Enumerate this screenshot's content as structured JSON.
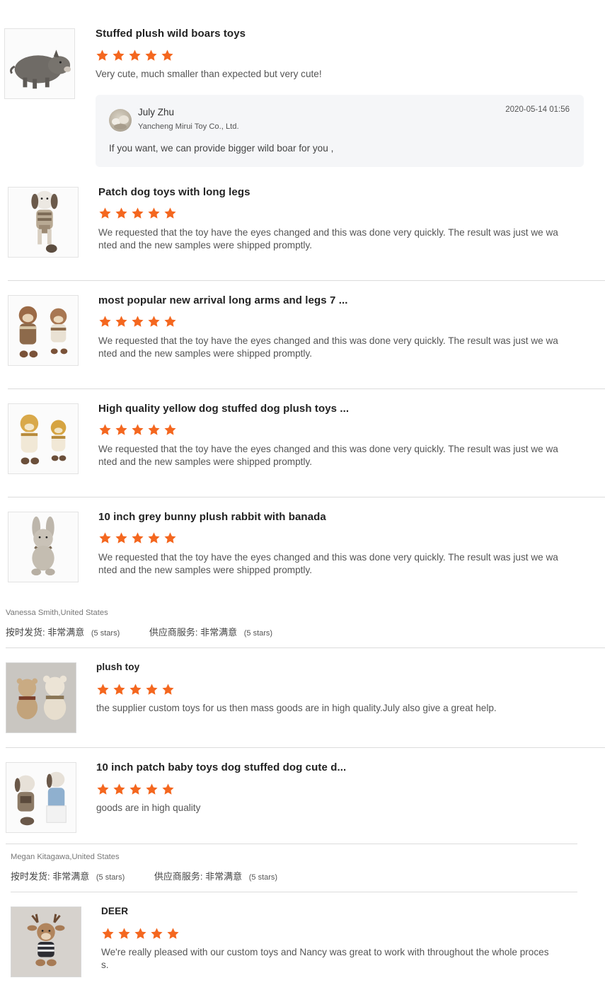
{
  "star_color": "#f4671f",
  "reviews_a": [
    {
      "title": "Stuffed plush wild boars toys",
      "rating": 5,
      "text": "Very cute, much smaller than expected but very cute!",
      "image_icon": "wild-boar-plush-icon"
    },
    {
      "title": "Patch dog toys with long legs",
      "rating": 5,
      "text_line1": "We requested that the toy have the eyes changed and this was done very quickly. The result was just we wa",
      "text_line2": "nted and the new samples were shipped promptly.",
      "image_icon": "patch-dog-plush-icon"
    },
    {
      "title": "most popular new arrival long arms and legs 7 ...",
      "rating": 5,
      "text_line1": "We requested that the toy have the eyes changed and this was done very quickly. The result was just we wa",
      "text_line2": "nted and the new samples were shipped promptly.",
      "image_icon": "monkey-plush-icon"
    },
    {
      "title": "High quality yellow dog stuffed dog plush toys ...",
      "rating": 5,
      "text_line1": "We requested that the toy have the eyes changed and this was done very quickly. The result was just we wa",
      "text_line2": "nted and the new samples were shipped promptly.",
      "image_icon": "yellow-dog-plush-icon"
    },
    {
      "title": "10 inch grey bunny plush rabbit with banada",
      "rating": 5,
      "text_line1": "We requested that the toy have the eyes changed and this was done very quickly. The result was just we wa",
      "text_line2": "nted and the new samples were shipped promptly.",
      "image_icon": "grey-bunny-plush-icon"
    }
  ],
  "supplier_reply": {
    "name": "July Zhu",
    "company": "Yancheng Mirui Toy Co., Ltd.",
    "date": "2020-05-14 01:56",
    "message": "If you want, we can provide bigger wild boar for you ,"
  },
  "reviewer_1": {
    "name": "Vanessa Smith,United States",
    "delivery_label": "按时发货:",
    "delivery_value": "非常满意",
    "delivery_count": "(5 stars)",
    "service_label": "供应商服务:",
    "service_value": "非常满意",
    "service_count": "(5 stars)"
  },
  "reviews_b": [
    {
      "title": "plush toy",
      "rating": 5,
      "text": "the supplier custom toys for us then mass goods are in high quality.July also give a great help.",
      "image_icon": "teddy-bears-plush-icon"
    },
    {
      "title": "10 inch patch baby toys dog stuffed dog cute d...",
      "rating": 5,
      "text": "goods are in high quality",
      "image_icon": "patch-baby-dogs-plush-icon"
    }
  ],
  "reviewer_2": {
    "name": "Megan Kitagawa,United States",
    "delivery_label": "按时发货:",
    "delivery_value": "非常满意",
    "delivery_count": "(5 stars)",
    "service_label": "供应商服务:",
    "service_value": "非常满意",
    "service_count": "(5 stars)"
  },
  "reviews_c": [
    {
      "title": "DEER",
      "rating": 5,
      "text_line1": "We're really pleased with our custom toys and Nancy was great to work with throughout the whole proces",
      "text_line2": "s.",
      "image_icon": "deer-plush-icon"
    }
  ]
}
